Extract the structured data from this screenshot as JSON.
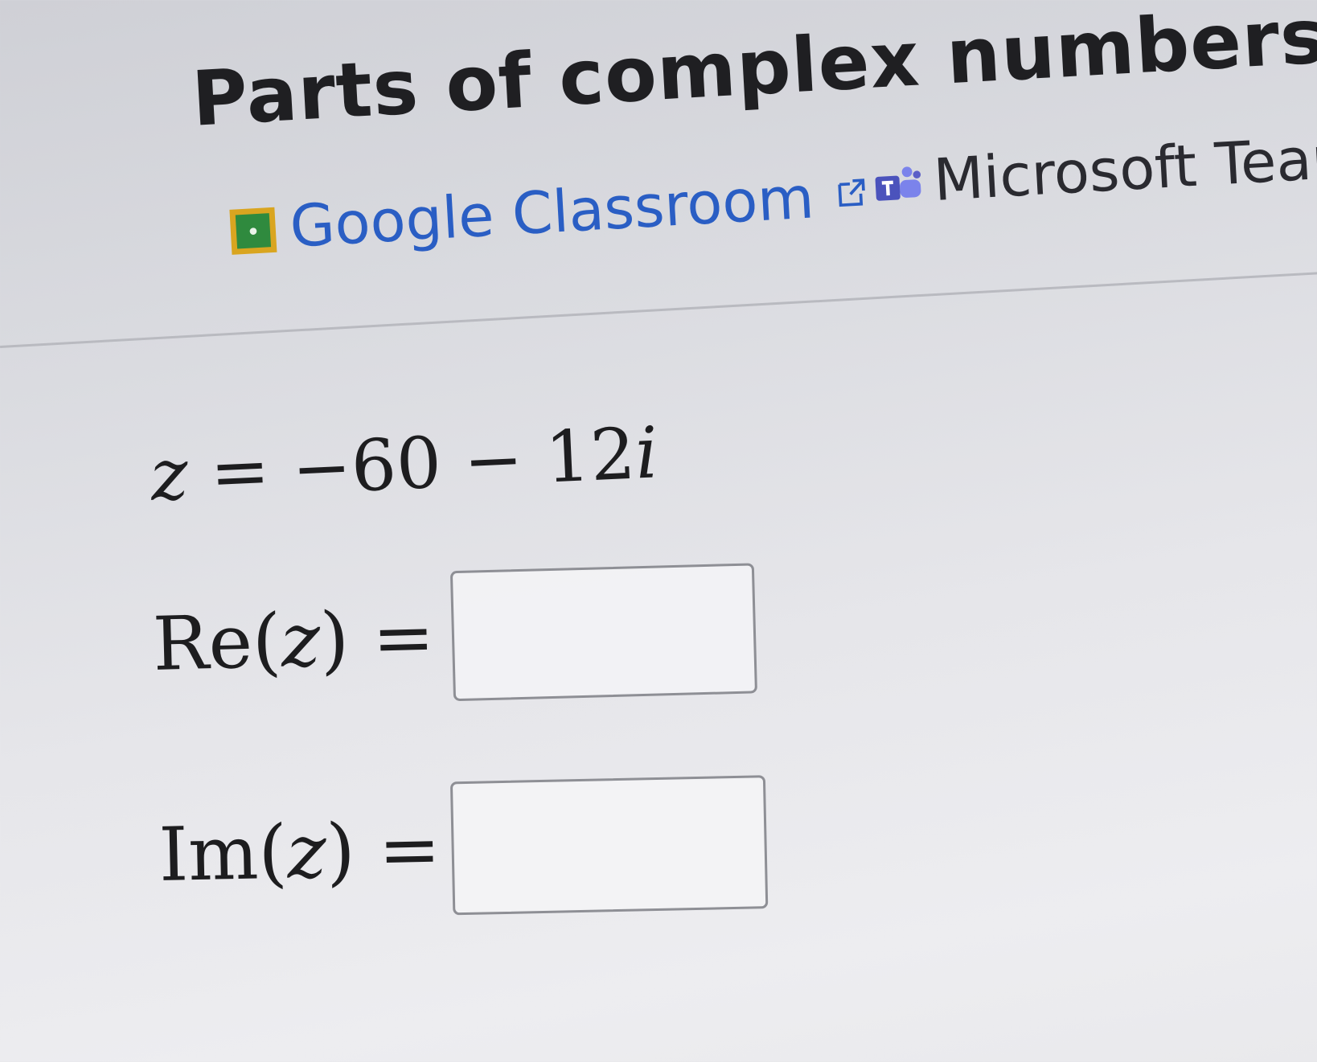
{
  "title": "Parts of complex numbers",
  "share": {
    "google_classroom_label": "Google Classroom",
    "microsoft_teams_label": "Microsoft Teams"
  },
  "problem": {
    "lhs": "z",
    "equals": "=",
    "rhs_number": "−60 − 12",
    "rhs_imag_unit": "i"
  },
  "answers": [
    {
      "label_prefix": "Re(",
      "label_var": "z",
      "label_suffix": ") =",
      "value": ""
    },
    {
      "label_prefix": "Im(",
      "label_var": "z",
      "label_suffix": ") =",
      "value": ""
    }
  ],
  "colors": {
    "link_blue": "#2a5ec4",
    "classroom_green": "#2f8a3e",
    "classroom_yellow": "#d9a520",
    "teams_purple": "#5b5fc7"
  },
  "icons": [
    "google-classroom-icon",
    "external-link-icon",
    "microsoft-teams-icon"
  ]
}
